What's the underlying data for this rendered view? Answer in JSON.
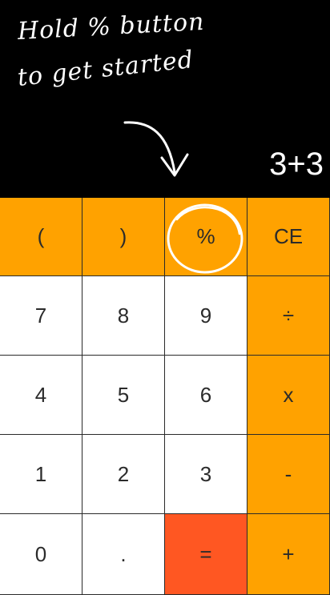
{
  "hint": {
    "line1": "Hold % button",
    "line2": "to get started"
  },
  "display": {
    "expression": "3+3"
  },
  "keys": [
    {
      "label": "(",
      "name": "open-paren-key",
      "color": "orange"
    },
    {
      "label": ")",
      "name": "close-paren-key",
      "color": "orange"
    },
    {
      "label": "%",
      "name": "percent-key",
      "color": "orange"
    },
    {
      "label": "CE",
      "name": "clear-entry-key",
      "color": "orange"
    },
    {
      "label": "7",
      "name": "digit-7-key",
      "color": "white"
    },
    {
      "label": "8",
      "name": "digit-8-key",
      "color": "white"
    },
    {
      "label": "9",
      "name": "digit-9-key",
      "color": "white"
    },
    {
      "label": "÷",
      "name": "divide-key",
      "color": "orange"
    },
    {
      "label": "4",
      "name": "digit-4-key",
      "color": "white"
    },
    {
      "label": "5",
      "name": "digit-5-key",
      "color": "white"
    },
    {
      "label": "6",
      "name": "digit-6-key",
      "color": "white"
    },
    {
      "label": "x",
      "name": "multiply-key",
      "color": "orange"
    },
    {
      "label": "1",
      "name": "digit-1-key",
      "color": "white"
    },
    {
      "label": "2",
      "name": "digit-2-key",
      "color": "white"
    },
    {
      "label": "3",
      "name": "digit-3-key",
      "color": "white"
    },
    {
      "label": "-",
      "name": "subtract-key",
      "color": "orange"
    },
    {
      "label": "0",
      "name": "digit-0-key",
      "color": "white"
    },
    {
      "label": ".",
      "name": "decimal-key",
      "color": "white"
    },
    {
      "label": "=",
      "name": "equals-key",
      "color": "red"
    },
    {
      "label": "+",
      "name": "add-key",
      "color": "orange"
    }
  ],
  "colors": {
    "orange": "#FFA200",
    "white": "#FFFFFF",
    "red": "#FF5722",
    "background": "#000000"
  },
  "icons": {
    "arrow": "curved-down-arrow-icon",
    "circle": "highlight-circle-icon"
  }
}
